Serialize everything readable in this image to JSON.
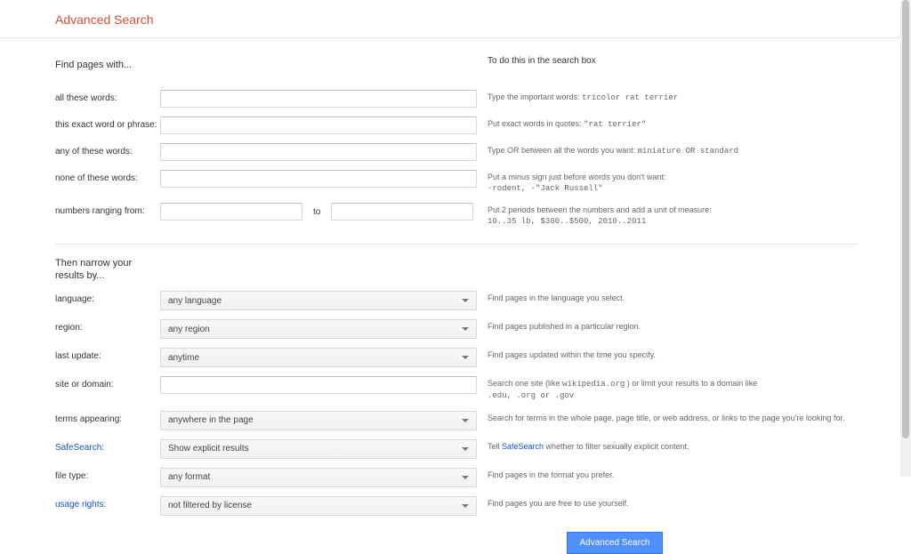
{
  "header": {
    "title": "Advanced Search"
  },
  "find": {
    "heading": "Find pages with...",
    "help_heading": "To do this in the search box",
    "rows": [
      {
        "label": "all these words:",
        "help": "Type the important words:",
        "example": "tricolor rat terrier"
      },
      {
        "label": "this exact word or phrase:",
        "help": "Put exact words in quotes:",
        "example": "\"rat terrier\""
      },
      {
        "label": "any of these words:",
        "help": "Type OR between all the words you want:",
        "example": "miniature OR standard"
      },
      {
        "label": "none of these words:",
        "help": "Put a minus sign just before words you don't want:",
        "example": "-rodent, -\"Jack Russell\""
      },
      {
        "label": "numbers ranging from:",
        "to": "to",
        "help": "Put 2 periods between the numbers and add a unit of measure:",
        "example": "10..35 lb, $300..$500, 2010..2011"
      }
    ]
  },
  "narrow": {
    "heading": "Then narrow your results by...",
    "rows": [
      {
        "label": "language:",
        "value": "any language",
        "help": "Find pages in the language you select.",
        "type": "dropdown"
      },
      {
        "label": "region:",
        "value": "any region",
        "help": "Find pages published in a particular region.",
        "type": "dropdown"
      },
      {
        "label": "last update:",
        "value": "anytime",
        "help": "Find pages updated within the time you specify.",
        "type": "dropdown"
      },
      {
        "label": "site or domain:",
        "value": "",
        "help_pre": "Search one site (like ",
        "help_mono": "wikipedia.org",
        "help_mid": " ) or limit your results to a domain like ",
        "help_mono2": ".edu, .org or .gov",
        "type": "text"
      },
      {
        "label": "terms appearing:",
        "value": "anywhere in the page",
        "help": "Search for terms in the whole page, page title, or web address, or links to the page you're looking for.",
        "type": "dropdown"
      },
      {
        "label": "SafeSearch:",
        "label_link": true,
        "value": "Show explicit results",
        "help_pre": "Tell ",
        "help_link": "SafeSearch",
        "help_post": " whether to filter sexually explicit content.",
        "type": "dropdown"
      },
      {
        "label": "file type:",
        "value": "any format",
        "help": "Find pages in the format you prefer.",
        "type": "dropdown"
      },
      {
        "label": "usage rights:",
        "label_link": true,
        "value": "not filtered by license",
        "help": "Find pages you are free to use yourself.",
        "type": "dropdown"
      }
    ]
  },
  "submit": {
    "label": "Advanced Search"
  }
}
